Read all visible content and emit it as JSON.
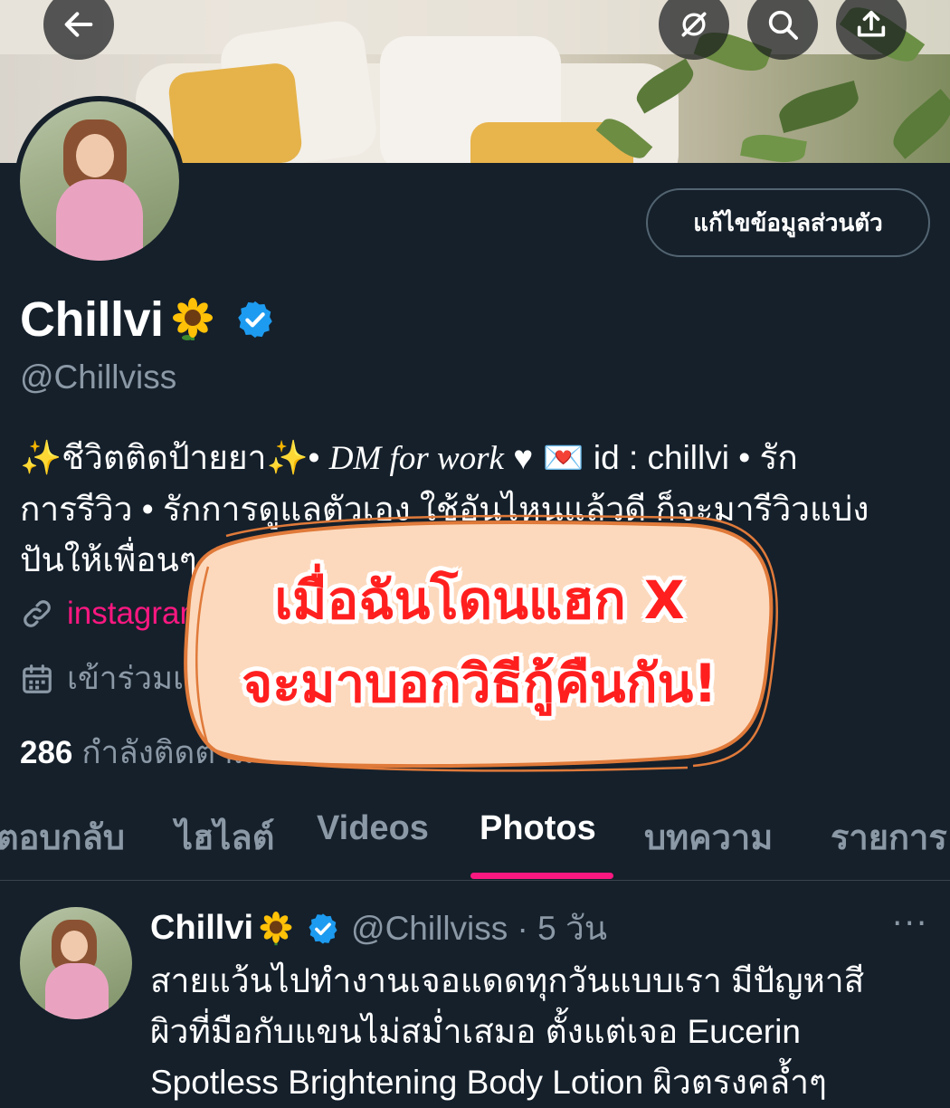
{
  "header": {
    "back_icon": "arrow-left-icon",
    "grok_icon": "grok-icon",
    "search_icon": "search-icon",
    "share_icon": "share-icon"
  },
  "profile": {
    "edit_profile_label": "แก้ไขข้อมูลส่วนตัว",
    "display_name": "Chillvi",
    "handle": "@Chillviss",
    "bio_line1_a": "✨ชีวิตติดป้ายยา✨• ",
    "bio_line1_italic": "DM for work",
    "bio_line1_b": " ♥ 💌 id : chillvi • รัก",
    "bio_line2": "การรีวิว • รักการดูแลตัวเอง ใช้อันไหนแล้วดี ก็จะมารีวิวแบ่ง",
    "bio_line3": "ปันให้เพื่อนๆ",
    "link_text": "instagram",
    "joined_text": "เข้าร่วมเมื่อ",
    "following_count": "286",
    "following_label": "กำลังติดตาม"
  },
  "tabs": [
    {
      "label": "ตอบกลับ"
    },
    {
      "label": "ไฮไลต์"
    },
    {
      "label": "Videos"
    },
    {
      "label": "Photos"
    },
    {
      "label": "บทความ"
    },
    {
      "label": "รายการ"
    }
  ],
  "active_tab": "Photos",
  "tweet": {
    "name": "Chillvi",
    "handle_time": "@Chillviss · 5 วัน",
    "more": "···",
    "text_line1": "สายแว้นไปทำงานเจอแดดทุกวันแบบเรา มีปัญหาสี",
    "text_line2": "ผิวที่มือกับแขนไม่สม่ำเสมอ ตั้งแต่เจอ Eucerin",
    "text_line3": "Spotless Brightening Body Lotion ผิวตรงคล้ำๆ"
  },
  "overlay": {
    "line1": "เมื่อฉันโดนแฮก X",
    "line2": "จะมาบอกวิธีกู้คืนกัน!"
  },
  "colors": {
    "background": "#15202b",
    "accent_pink": "#f91880",
    "verified_blue": "#1d9bf0",
    "muted_text": "#8b98a5",
    "sticker_fill": "#fcd9bd",
    "sticker_text": "#ff1f1f"
  }
}
